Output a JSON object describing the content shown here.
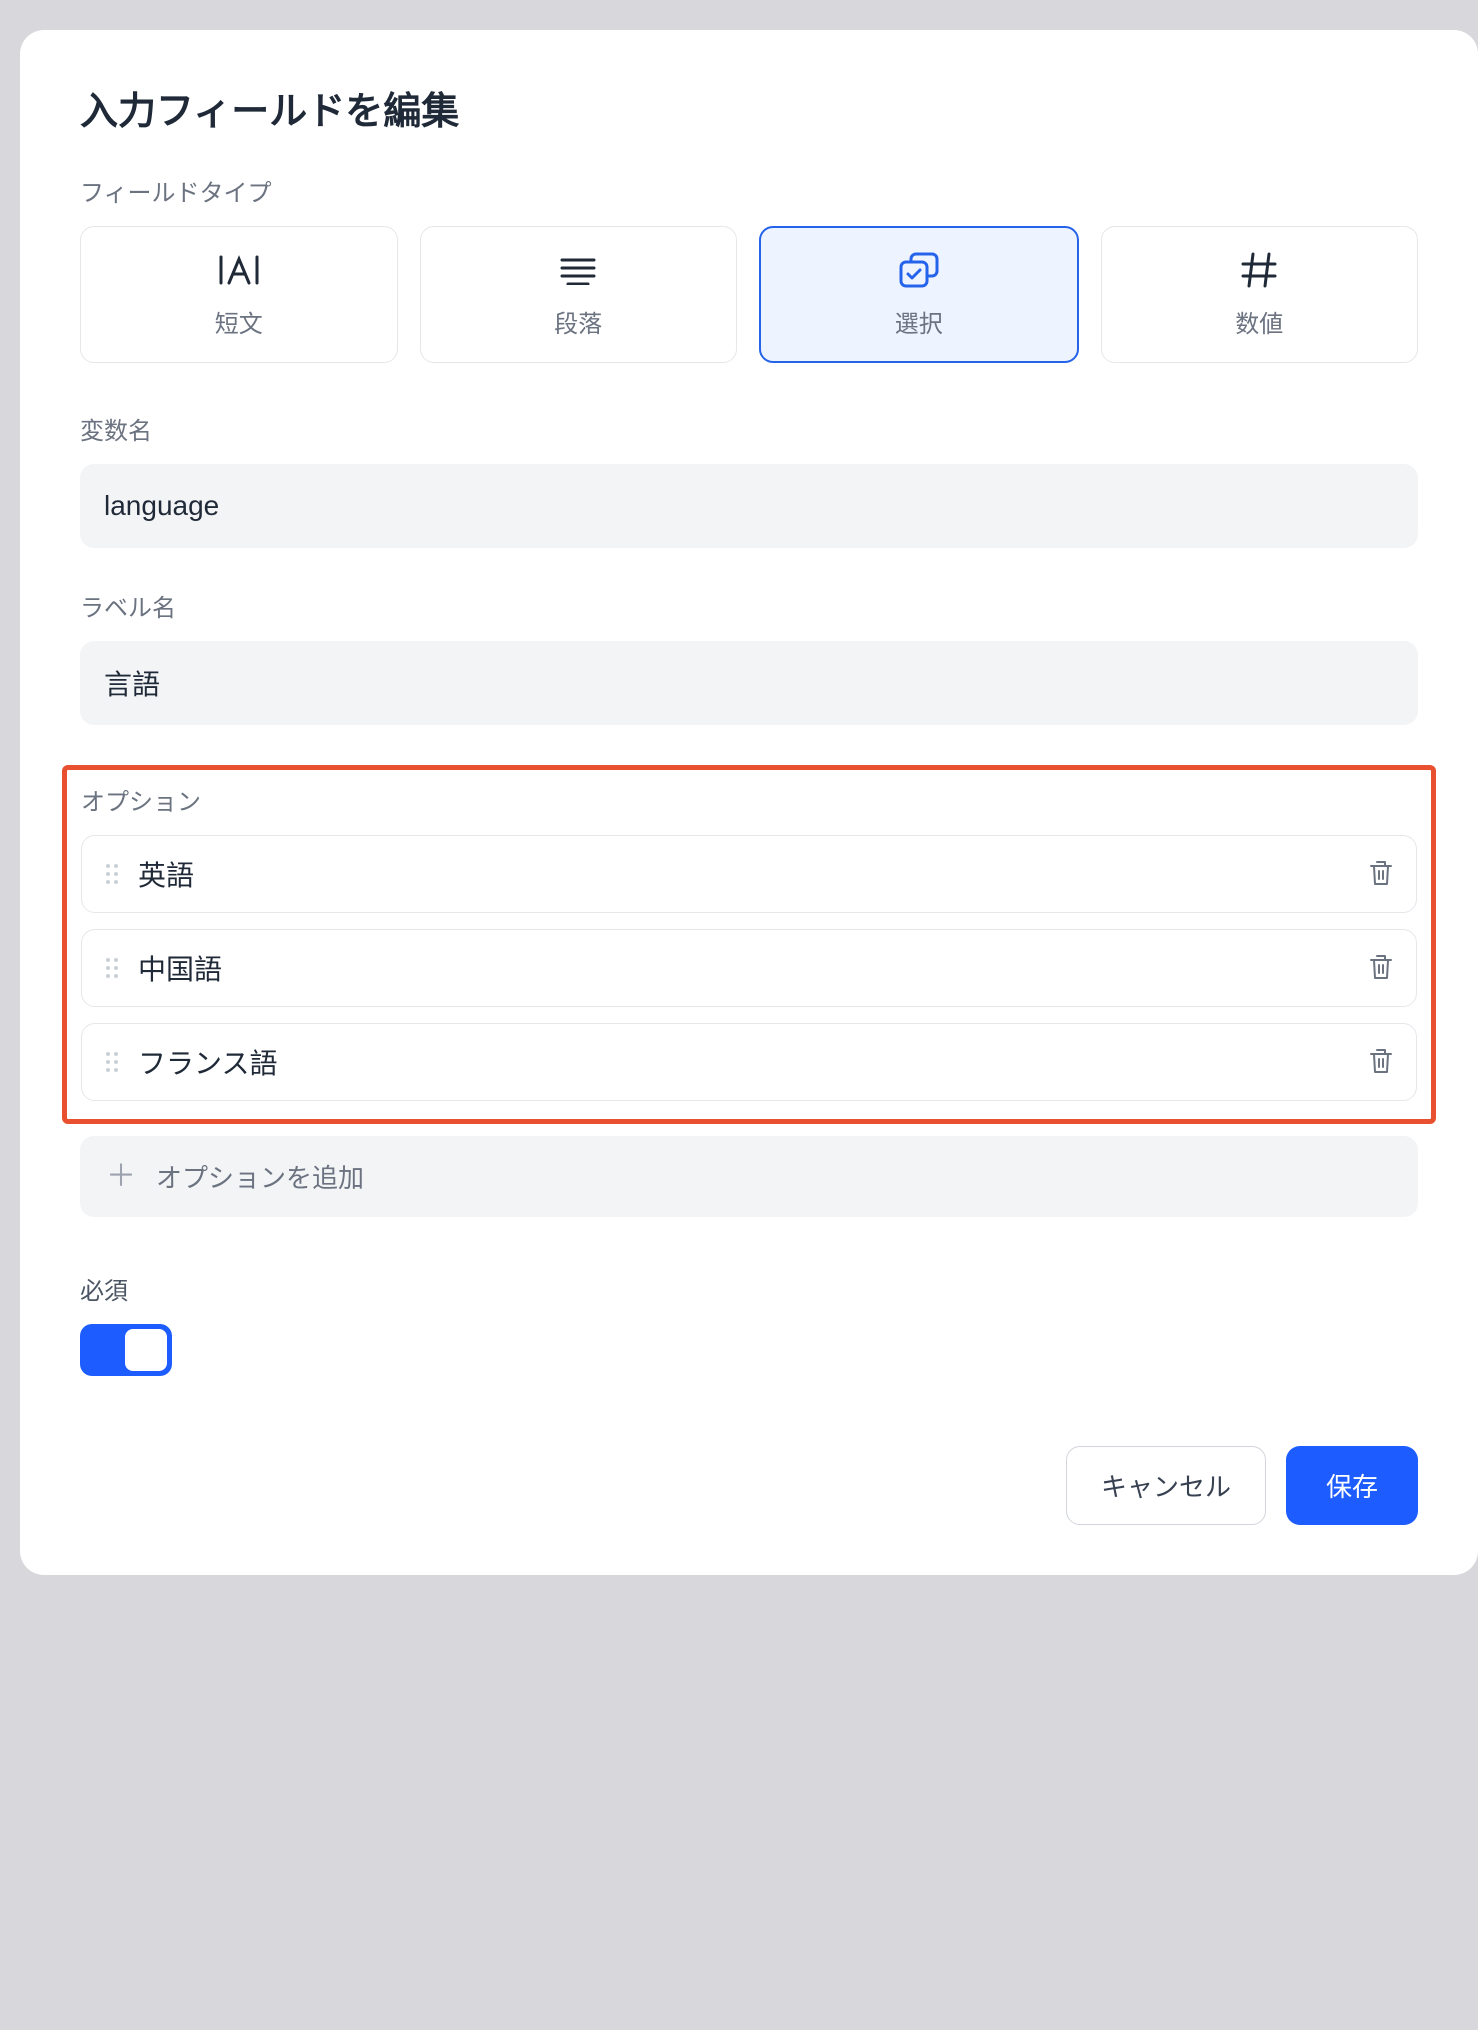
{
  "modal": {
    "title": "入力フィールドを編集"
  },
  "fieldType": {
    "label": "フィールドタイプ",
    "options": [
      {
        "label": "短文"
      },
      {
        "label": "段落"
      },
      {
        "label": "選択"
      },
      {
        "label": "数値"
      }
    ]
  },
  "variableName": {
    "label": "変数名",
    "value": "language"
  },
  "labelName": {
    "label": "ラベル名",
    "value": "言語"
  },
  "options": {
    "label": "オプション",
    "items": [
      {
        "text": "英語"
      },
      {
        "text": "中国語"
      },
      {
        "text": "フランス語"
      }
    ],
    "addLabel": "オプションを追加"
  },
  "required": {
    "label": "必須",
    "value": true
  },
  "footer": {
    "cancel": "キャンセル",
    "save": "保存"
  }
}
